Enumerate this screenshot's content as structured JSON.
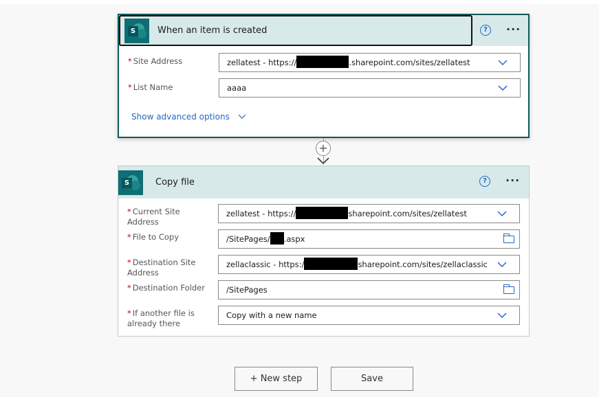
{
  "trigger": {
    "title": "When an item is created",
    "icon": "sharepoint-icon",
    "help_icon": "question-circle-icon",
    "more_icon": "more-ellipsis-icon",
    "more_label": "···",
    "help_label": "?",
    "sp_letter": "S",
    "fields": [
      {
        "label": "Site Address",
        "value_prefix": "zellatest - https://",
        "value_suffix": ".sharepoint.com/sites/zellatest",
        "control": "dropdown"
      },
      {
        "label": "List Name",
        "value": "aaaa",
        "control": "dropdown"
      }
    ],
    "advanced_link": "Show advanced options"
  },
  "connector": {
    "plus_label": "+"
  },
  "action": {
    "title": "Copy file",
    "icon": "sharepoint-icon",
    "help_label": "?",
    "more_label": "···",
    "sp_letter": "S",
    "fields": [
      {
        "label": "Current Site Address",
        "value_prefix": "zellatest - https://",
        "value_suffix": "sharepoint.com/sites/zellatest",
        "control": "dropdown"
      },
      {
        "label": "File to Copy",
        "value_prefix": "/SitePages/",
        "value_suffix": ".aspx",
        "control": "folder-picker"
      },
      {
        "label": "Destination Site Address",
        "value_prefix": "zellaclassic - https:/",
        "value_suffix": "sharepoint.com/sites/zellaclassic",
        "control": "dropdown"
      },
      {
        "label": "Destination Folder",
        "value": "/SitePages",
        "control": "folder-picker"
      },
      {
        "label": "If another file is already there",
        "value": "Copy with a new name",
        "control": "dropdown"
      }
    ]
  },
  "footer": {
    "new_step_label": "+ New step",
    "save_label": "Save"
  },
  "colors": {
    "header_bg": "#d8e9e9",
    "sharepoint_teal": "#0e6e73",
    "accent_blue": "#2468c4",
    "active_border": "#0b5a5a",
    "required_red": "#cc0000"
  }
}
